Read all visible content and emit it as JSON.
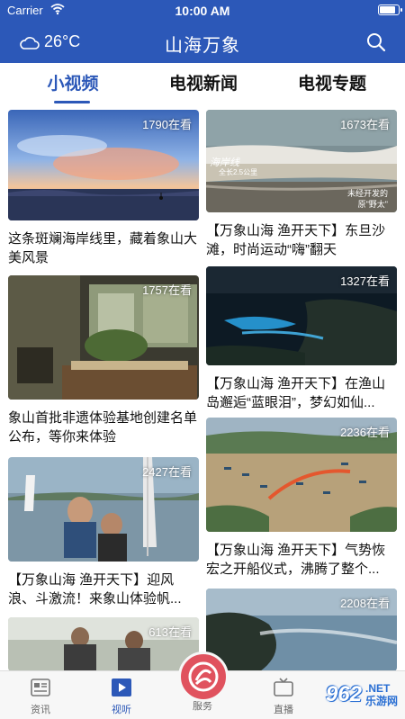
{
  "status_bar": {
    "carrier": "Carrier",
    "time": "10:00 AM",
    "battery_level": 0.9
  },
  "header": {
    "temperature": "26°C",
    "title": "山海万象"
  },
  "tabs": [
    {
      "label": "小视频",
      "active": true
    },
    {
      "label": "电视新闻",
      "active": false
    },
    {
      "label": "电视专题",
      "active": false
    }
  ],
  "cards": [
    {
      "views": "1790在看",
      "title": "这条斑斓海岸线里，藏着象山大美风景"
    },
    {
      "views": "1673在看",
      "title": "【万象山海 渔开天下】东旦沙滩，时尚运动“嗨”翻天"
    },
    {
      "views": "1757在看",
      "title": "象山首批非遗体验基地创建名单公布，等你来体验"
    },
    {
      "views": "1327在看",
      "title": "【万象山海 渔开天下】在渔山岛邂逅“蓝眼泪”，梦幻如仙..."
    },
    {
      "views": "2427在看",
      "title": "【万象山海 渔开天下】迎风浪、斗激流！来象山体验帆..."
    },
    {
      "views": "2236在看",
      "title": "【万象山海 渔开天下】气势恢宏之开船仪式，沸腾了整个..."
    },
    {
      "views": "613在看",
      "title": ""
    },
    {
      "views": "2208在看",
      "title": ""
    }
  ],
  "thumb_overlay_text": {
    "card2_a": "海岸线",
    "card2_b": "全长2.5公里",
    "card2_c": "未经开发的",
    "card2_d": "原\"野太\""
  },
  "bottom_nav": [
    {
      "label": "资讯",
      "icon": "news-icon",
      "active": false
    },
    {
      "label": "视听",
      "icon": "play-icon",
      "active": true
    },
    {
      "label": "服务",
      "icon": "service-icon",
      "active": false
    },
    {
      "label": "直播",
      "icon": "tv-icon",
      "active": false
    }
  ],
  "watermark": {
    "brand": "962",
    "domain": ".NET",
    "sub": "乐游网"
  },
  "colors": {
    "primary": "#2c58b8",
    "accent": "#e0525e"
  }
}
